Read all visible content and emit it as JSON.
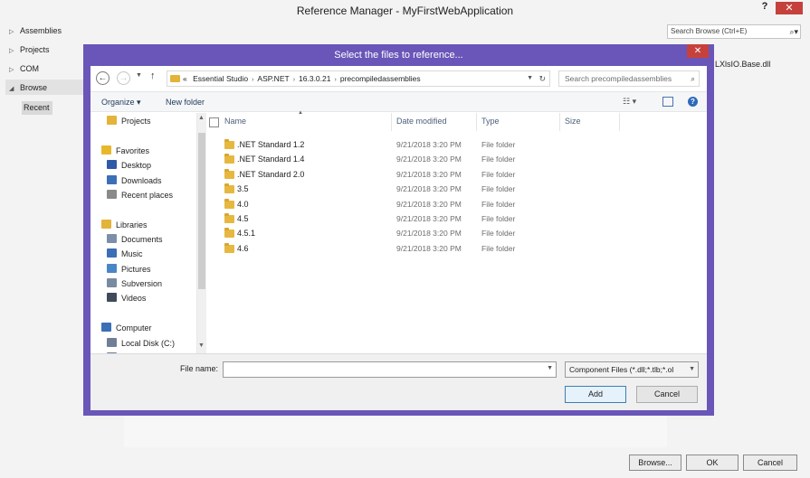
{
  "reference_manager": {
    "title": "Reference Manager - MyFirstWebApplication",
    "help_label": "?",
    "close_label": "✕",
    "nav": [
      {
        "label": "Assemblies"
      },
      {
        "label": "Projects"
      },
      {
        "label": "COM"
      },
      {
        "label": "Browse"
      }
    ],
    "recent_label": "Recent",
    "search_placeholder": "Search Browse (Ctrl+E)",
    "extra_text": "LXlsIO.Base.dll",
    "buttons": {
      "browse": "Browse...",
      "ok": "OK",
      "cancel": "Cancel"
    }
  },
  "dialog": {
    "title": "Select the files to reference...",
    "close_label": "✕",
    "address": {
      "prefix": "«",
      "crumbs": [
        "Essential Studio",
        "ASP.NET",
        "16.3.0.21",
        "precompiledassemblies"
      ]
    },
    "search_placeholder": "Search precompiledassemblies",
    "toolbar": {
      "organize": "Organize ▾",
      "new_folder": "New folder"
    },
    "tree": [
      {
        "label": "Projects",
        "icon": "folder-icon",
        "color": "#e3b33a"
      },
      {
        "label": "Favorites",
        "icon": "star-icon",
        "color": "#e8b82c"
      },
      {
        "label": "Desktop",
        "icon": "desktop-icon",
        "color": "#2e5aa8"
      },
      {
        "label": "Downloads",
        "icon": "downloads-icon",
        "color": "#3b6fb6"
      },
      {
        "label": "Recent places",
        "icon": "recent-places-icon",
        "color": "#8a8a8a"
      },
      {
        "label": "Libraries",
        "icon": "libraries-icon",
        "color": "#e3b33a"
      },
      {
        "label": "Documents",
        "icon": "documents-icon",
        "color": "#7d8fa8"
      },
      {
        "label": "Music",
        "icon": "music-icon",
        "color": "#3b6fb6"
      },
      {
        "label": "Pictures",
        "icon": "pictures-icon",
        "color": "#4a86c7"
      },
      {
        "label": "Subversion",
        "icon": "subversion-icon",
        "color": "#7a8aa0"
      },
      {
        "label": "Videos",
        "icon": "videos-icon",
        "color": "#404b5a"
      },
      {
        "label": "Computer",
        "icon": "computer-icon",
        "color": "#3b6fb6"
      },
      {
        "label": "Local Disk (C:)",
        "icon": "disk-icon",
        "color": "#6f7f95"
      },
      {
        "label": "Local Disk (D:)",
        "icon": "disk-icon",
        "color": "#6f7f95"
      }
    ],
    "columns": {
      "name": "Name",
      "date": "Date modified",
      "type": "Type",
      "size": "Size"
    },
    "files": [
      {
        "name": ".NET Standard 1.2",
        "date": "9/21/2018 3:20 PM",
        "type": "File folder"
      },
      {
        "name": ".NET Standard 1.4",
        "date": "9/21/2018 3:20 PM",
        "type": "File folder"
      },
      {
        "name": ".NET Standard 2.0",
        "date": "9/21/2018 3:20 PM",
        "type": "File folder"
      },
      {
        "name": "3.5",
        "date": "9/21/2018 3:20 PM",
        "type": "File folder"
      },
      {
        "name": "4.0",
        "date": "9/21/2018 3:20 PM",
        "type": "File folder"
      },
      {
        "name": "4.5",
        "date": "9/21/2018 3:20 PM",
        "type": "File folder"
      },
      {
        "name": "4.5.1",
        "date": "9/21/2018 3:20 PM",
        "type": "File folder"
      },
      {
        "name": "4.6",
        "date": "9/21/2018 3:20 PM",
        "type": "File folder"
      }
    ],
    "file_name_label": "File name:",
    "file_name_value": "",
    "filter_value": "Component Files (*.dll;*.tlb;*.ol",
    "buttons": {
      "add": "Add",
      "cancel": "Cancel"
    },
    "accent_color": "#6956b8"
  }
}
